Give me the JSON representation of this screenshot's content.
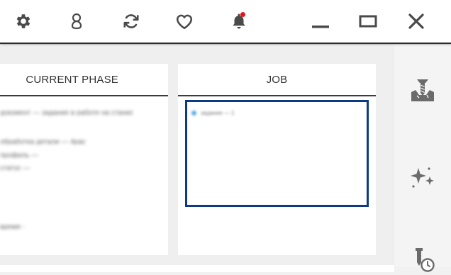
{
  "toolbar": {
    "settings_icon": "gear-icon",
    "account_icon": "user-icon",
    "refresh_icon": "sync-icon",
    "favorites_icon": "heart-icon",
    "notifications_icon": "bell-icon",
    "notification_badge_color": "#e8141c",
    "minimize_icon": "minimize-icon",
    "maximize_icon": "maximize-icon",
    "close_icon": "close-icon",
    "icon_color": "#4a4a4a"
  },
  "panels": {
    "current_phase": {
      "title": "CURRENT PHASE",
      "lines": [
        "документ — задание в работе на станке",
        "обработка детали — 4рас",
        "профиль —",
        "статус —",
        "время —"
      ]
    },
    "job": {
      "title": "JOB",
      "items": [
        "задание — 1"
      ],
      "accent": "#0d3a84",
      "item_dot_color": "#57a9e8"
    }
  },
  "rail": {
    "items": [
      {
        "icon": "drill-icon"
      },
      {
        "icon": "sparkle-icon"
      },
      {
        "icon": "tool-timer-icon"
      }
    ]
  }
}
